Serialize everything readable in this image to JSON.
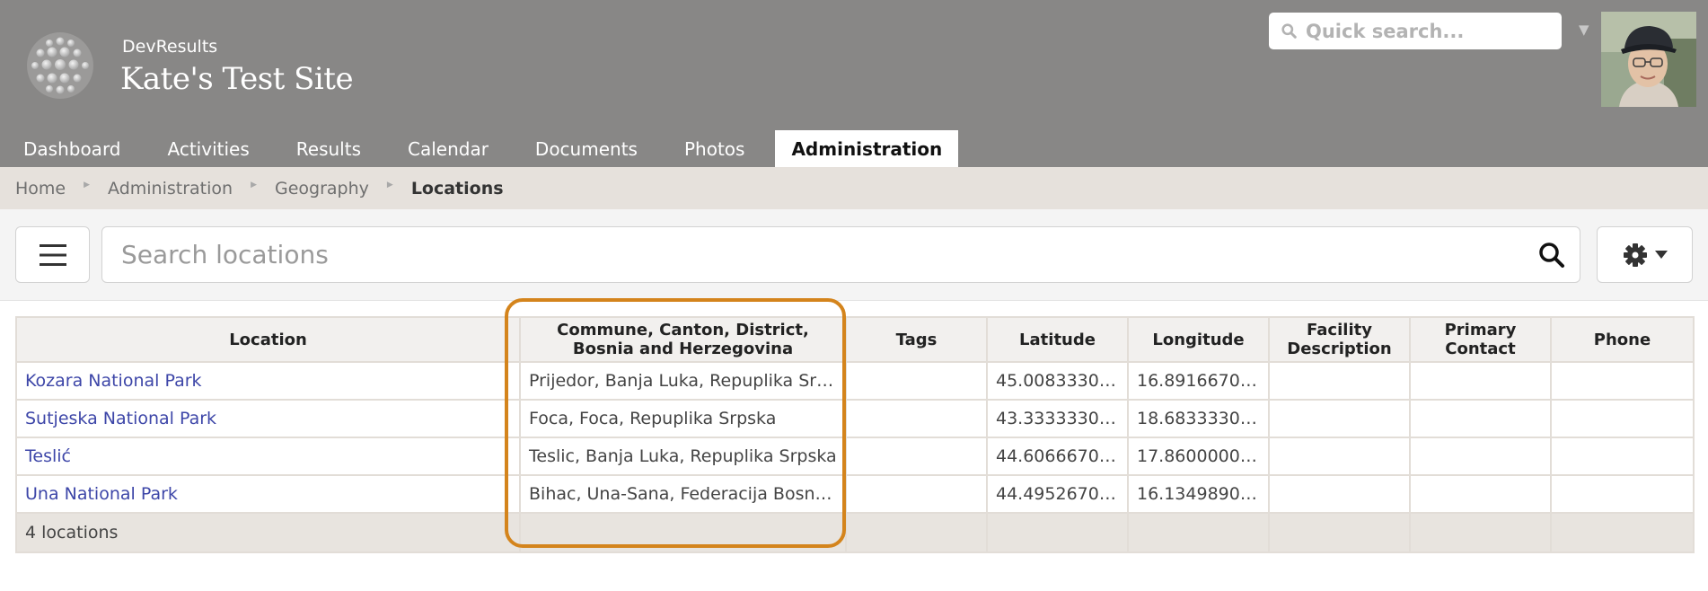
{
  "header": {
    "brand_small": "DevResults",
    "brand_title": "Kate's Test Site",
    "quick_search_placeholder": "Quick search...",
    "user_menu_icon": "caret-down-icon"
  },
  "nav": {
    "items": [
      {
        "label": "Dashboard"
      },
      {
        "label": "Activities"
      },
      {
        "label": "Results"
      },
      {
        "label": "Calendar"
      },
      {
        "label": "Documents"
      },
      {
        "label": "Photos"
      },
      {
        "label": "Administration",
        "active": true
      }
    ]
  },
  "breadcrumb": {
    "items": [
      "Home",
      "Administration",
      "Geography"
    ],
    "current": "Locations"
  },
  "toolbar": {
    "menu_icon": "hamburger-icon",
    "search_placeholder": "Search locations",
    "search_icon": "search-icon",
    "settings_icon": "gear-icon"
  },
  "table": {
    "headers": [
      "Location",
      "Commune, Canton, District, Bosnia and Herzegovina",
      "Tags",
      "Latitude",
      "Longitude",
      "Facility Description",
      "Primary Contact",
      "Phone"
    ],
    "rows": [
      [
        "Kozara National Park",
        "Prijedor, Banja Luka, Repuplika Srpska",
        "",
        "45.008333000",
        "16.891667000",
        "",
        "",
        ""
      ],
      [
        "Sutjeska National Park",
        "Foca, Foca, Repuplika Srpska",
        "",
        "43.333333000",
        "18.683333000",
        "",
        "",
        ""
      ],
      [
        "Teslić",
        "Teslic, Banja Luka, Repuplika Srpska",
        "",
        "44.606667000",
        "17.860000000",
        "",
        "",
        ""
      ],
      [
        "Una National Park",
        "Bihac, Una-Sana, Federacija Bosna i Hercegovina",
        "",
        "44.495267000",
        "16.134989000",
        "",
        "",
        ""
      ]
    ],
    "footer": "4 locations"
  },
  "colors": {
    "header_bg": "#888786",
    "link": "#3d46a8",
    "highlight": "#d4841c",
    "breadcrumb_bg": "#e6e1dc"
  }
}
